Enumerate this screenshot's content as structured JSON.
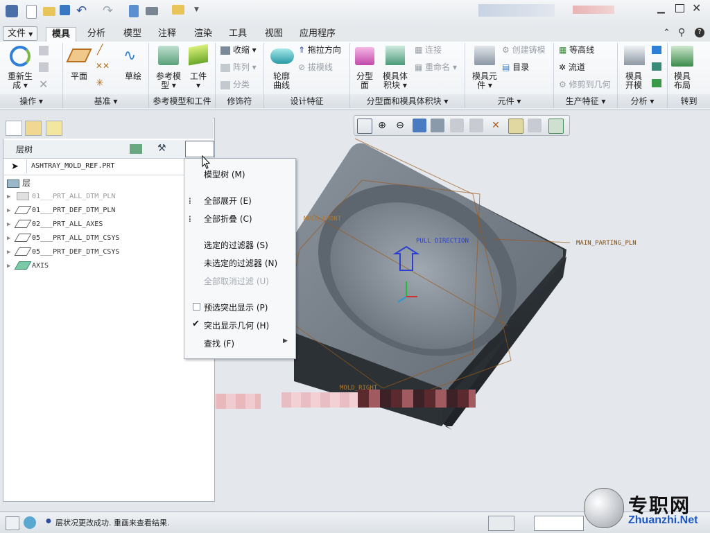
{
  "ribbon": {
    "file_tab": "文件",
    "tabs": [
      "模具",
      "分析",
      "模型",
      "注释",
      "渲染",
      "工具",
      "视图",
      "应用程序"
    ],
    "active_tab": "模具",
    "regenerate": [
      "重新生",
      "成"
    ],
    "plane": "平面",
    "sketch": "草绘",
    "ref_model": [
      "参考模",
      "型"
    ],
    "workpiece": "工件",
    "shrink": "收缩",
    "pattern": "阵列",
    "classify": "分类",
    "contour_curve": [
      "轮廓",
      "曲线"
    ],
    "drag_direction": "拖拉方向",
    "draft_line": "拔模线",
    "parting_surface": [
      "分型",
      "面"
    ],
    "mold_volume": [
      "模具体",
      "积块"
    ],
    "connect": "连接",
    "rename": "重命名",
    "mold_component": [
      "模具元",
      "件"
    ],
    "create_casting": "创建铸模",
    "catalog": "目录",
    "contour_line": "等高线",
    "runner": "流道",
    "trim_to_geometry": "修剪到几何",
    "mold_open": [
      "模具",
      "开模"
    ],
    "mold_layout": [
      "模具",
      "布局"
    ],
    "groups": [
      "操作",
      "基准",
      "参考模型和工件",
      "修饰符",
      "设计特征",
      "分型面和模具体积块",
      "元件",
      "生产特征",
      "分析",
      "转到"
    ]
  },
  "left_panel": {
    "title": "层树",
    "model_name": "ASHTRAY_MOLD_REF.PRT",
    "root": "层",
    "layers": [
      {
        "name": "01___PRT_ALL_DTM_PLN",
        "dim": true
      },
      {
        "name": "01___PRT_DEF_DTM_PLN",
        "dim": false
      },
      {
        "name": "02___PRT_ALL_AXES",
        "dim": false
      },
      {
        "name": "05___PRT_ALL_DTM_CSYS",
        "dim": false
      },
      {
        "name": "05___PRT_DEF_DTM_CSYS",
        "dim": false
      },
      {
        "name": "AXIS",
        "dim": false
      }
    ]
  },
  "menu": {
    "model_tree": "模型树 (M)",
    "expand_all": "全部展开 (E)",
    "collapse_all": "全部折叠 (C)",
    "selected_filter": "选定的过滤器 (S)",
    "unselected_filter": "未选定的过滤器 (N)",
    "clear_all_filters": "全部取消过滤 (U)",
    "preselect_highlight": "预选突出显示 (P)",
    "highlight_geometry": "突出显示几何 (H)",
    "find": "查找 (F)",
    "preselect_checked": false,
    "highlight_checked": true
  },
  "viewport": {
    "pull_direction": "PULL DIRECTION",
    "main_parting": "MAIN_PARTING_PLN",
    "mold_front": "MOLD_FRONT",
    "mold_right": "MOLD_RIGHT"
  },
  "status": {
    "message": "层状况更改成功. 重画来查看结果."
  },
  "watermark": {
    "title": "专职网",
    "url": "Zhuanzhi.Net"
  }
}
